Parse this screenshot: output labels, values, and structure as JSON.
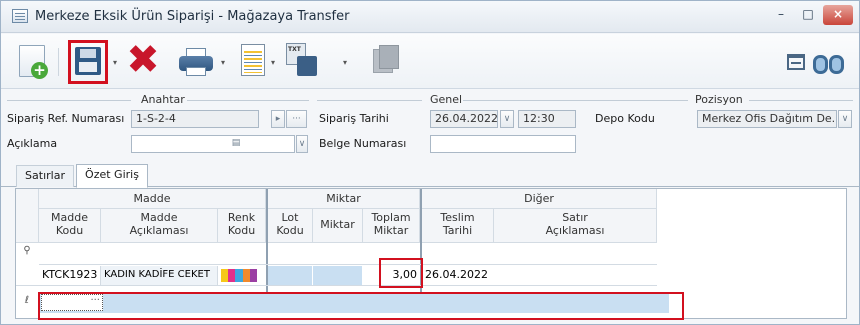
{
  "window": {
    "title": "Merkeze Eksik Ürün Siparişi - Mağazaya Transfer",
    "controls": {
      "minimize": "–",
      "maximize": "□",
      "close": "×"
    }
  },
  "toolbar": {
    "items": [
      "new-doc-icon",
      "save-icon",
      "delete-icon",
      "print-icon",
      "document-icon",
      "txt-save-icon",
      "copy-icon",
      "columns-icon",
      "binoculars-icon"
    ],
    "highlight_color": "#d2101f",
    "dropdown_glyph": "▾",
    "delete_glyph": "✖"
  },
  "header": {
    "groups": {
      "anahtar": "Anahtar",
      "genel": "Genel",
      "pozisyon": "Pozisyon"
    },
    "siparis_ref_label": "Sipariş Ref. Numarası",
    "siparis_ref_value": "1-S-2-4",
    "aciklama_label": "Açıklama",
    "aciklama_value": "",
    "siparis_tarihi_label": "Sipariş Tarihi",
    "siparis_tarihi_value": "26.04.2022",
    "siparis_saati_value": "12:30",
    "belge_numarasi_label": "Belge Numarası",
    "belge_numarasi_value": "",
    "depo_kodu_label": "Depo Kodu",
    "depo_kodu_value": "Merkez Ofis Dağıtım De...",
    "ellipsis": "···",
    "dropdown": "∨",
    "arrow": "▸"
  },
  "tabs": [
    {
      "label": "Satırlar",
      "active": false
    },
    {
      "label": "Özet Giriş",
      "active": true
    }
  ],
  "grid": {
    "bands": [
      "Madde",
      "Miktar",
      "Diğer"
    ],
    "columns": {
      "madde_kodu": "Madde\nKodu",
      "madde_aciklamasi": "Madde\nAçıklaması",
      "renk_kodu": "Renk\nKodu",
      "lot_kodu": "Lot\nKodu",
      "miktar": "Miktar",
      "toplam_miktar": "Toplam\nMiktar",
      "teslim_tarihi": "Teslim\nTarihi",
      "satir_aciklamasi": "Satır\nAçıklaması"
    },
    "filter_row_icon": "⚲",
    "rows": [
      {
        "madde_kodu": "KTCK1923",
        "madde_aciklamasi": "KADIN KADİFE CEKET",
        "renk_swatch_colors": [
          "#f6c81a",
          "#e0318b",
          "#3da7e0",
          "#f08a2d",
          "#9b3fa3"
        ],
        "lot_kodu": "",
        "miktar": "",
        "toplam_miktar": "3,00",
        "teslim_tarihi": "26.04.2022",
        "satir_aciklamasi": ""
      }
    ],
    "new_row_indicator": "ℓ",
    "new_row_editor_button": "···"
  }
}
